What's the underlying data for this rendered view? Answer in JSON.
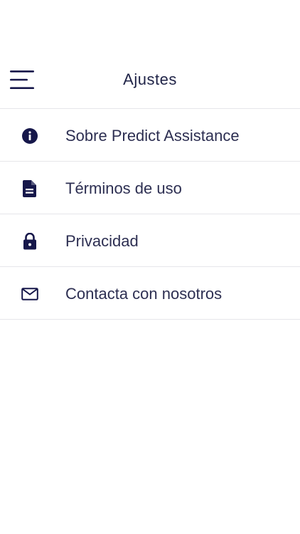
{
  "header": {
    "title": "Ajustes",
    "menu_icon": "hamburger-menu-icon"
  },
  "settings": {
    "items": [
      {
        "label": "Sobre Predict Assistance",
        "icon": "info-icon"
      },
      {
        "label": "Términos de uso",
        "icon": "document-icon"
      },
      {
        "label": "Privacidad",
        "icon": "lock-icon"
      },
      {
        "label": "Contacta con nosotros",
        "icon": "mail-icon"
      }
    ]
  },
  "colors": {
    "icon": "#16174a",
    "text": "#2d2f52",
    "divider": "#e6e6ea",
    "background": "#ffffff"
  }
}
